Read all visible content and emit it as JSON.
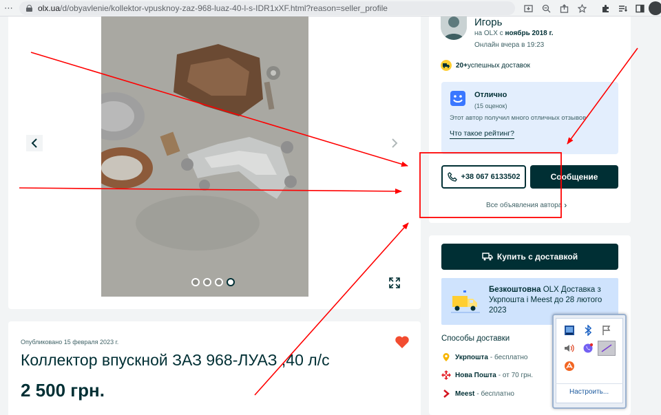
{
  "browser": {
    "url_host": "olx.ua",
    "url_path": "/d/obyavlenie/kollektor-vpusknoy-zaz-968-luaz-40-l-s-IDR1xXF.html?reason=seller_profile"
  },
  "listing": {
    "published": "Опубликовано 15 февраля 2023 г.",
    "title": "Коллектор впускной ЗАЗ 968-ЛУАЗ ,40 л/с",
    "price": "2 500 грн.",
    "photo_count": 4,
    "active_photo": 4
  },
  "seller": {
    "name": "Игорь",
    "since_prefix": "на OLX с ",
    "since_value": "ноябрь 2018 г.",
    "online": "Онлайн вчера в 19:23",
    "deliveries_count": "20+",
    "deliveries_label": " успешных доставок"
  },
  "rating": {
    "title": "Отлично",
    "count": "(15 оценок)",
    "description": "Этот автор получил много отличных отзывов",
    "link": "Что такое рейтинг?"
  },
  "actions": {
    "phone": "+38 067 6133502",
    "message": "Сообщение",
    "all_ads": "Все объявления автора"
  },
  "delivery": {
    "buy_button": "Купить с доставкой",
    "promo_bold": "Безкоштовна",
    "promo_rest": " OLX Доставка з Укрпошта і Meest до 28 лютого 2023",
    "methods_title": "Способы доставки",
    "methods": [
      {
        "name": "Укрпошта",
        "price": "- бесплатно",
        "color": "#f7b500"
      },
      {
        "name": "Нова Пошта",
        "price": "- от 70 грн.",
        "color": "#e4232b"
      },
      {
        "name": "Meest",
        "price": "- бесплатно",
        "color": "#d4141f"
      }
    ]
  },
  "tray": {
    "customize_link": "Настроить..."
  },
  "colors": {
    "brand_dark": "#002f34",
    "heart": "#f24c30",
    "annotation": "#ff0000"
  }
}
